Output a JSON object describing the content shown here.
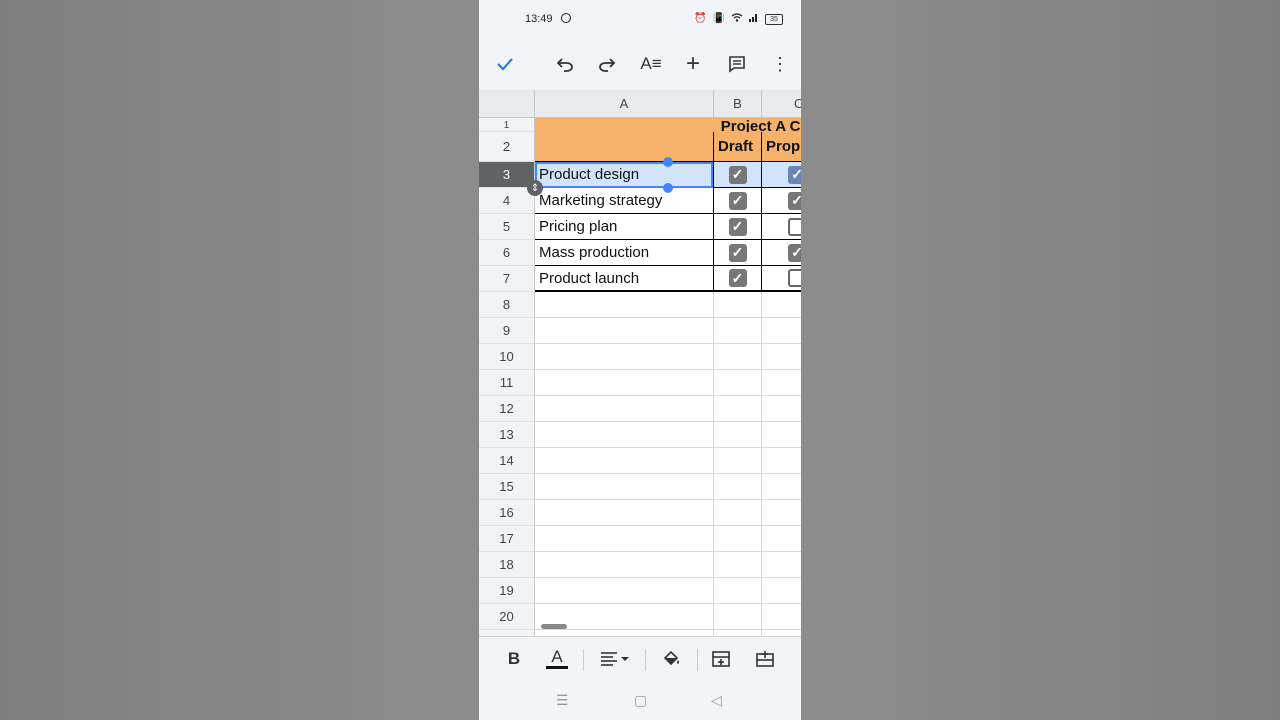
{
  "status": {
    "time": "13:49",
    "battery": "35"
  },
  "toolbar": {
    "icons": [
      "check-icon",
      "undo-icon",
      "redo-icon",
      "text-format-icon",
      "insert-icon",
      "comment-icon",
      "more-vert-icon"
    ]
  },
  "columns": [
    "A",
    "B",
    "C"
  ],
  "rows": [
    "1",
    "2",
    "3",
    "4",
    "5",
    "6",
    "7",
    "8",
    "9",
    "10",
    "11",
    "12",
    "13",
    "14",
    "15",
    "16",
    "17",
    "18",
    "19",
    "20"
  ],
  "sheet": {
    "title": "Project A Com",
    "headers": {
      "b": "Draft",
      "c": "Prop"
    },
    "items": [
      {
        "label": "Product design",
        "b": true,
        "c": true
      },
      {
        "label": "Marketing strategy",
        "b": true,
        "c": true
      },
      {
        "label": "Pricing plan",
        "b": true,
        "c": false
      },
      {
        "label": "Mass production",
        "b": true,
        "c": true
      },
      {
        "label": "Product launch",
        "b": true,
        "c": false
      }
    ],
    "selected_row": "3"
  },
  "format_bar": {
    "bold": "B",
    "text_color": "A"
  },
  "colors": {
    "header_fill": "#f6b26b",
    "selection": "#4285f4"
  }
}
